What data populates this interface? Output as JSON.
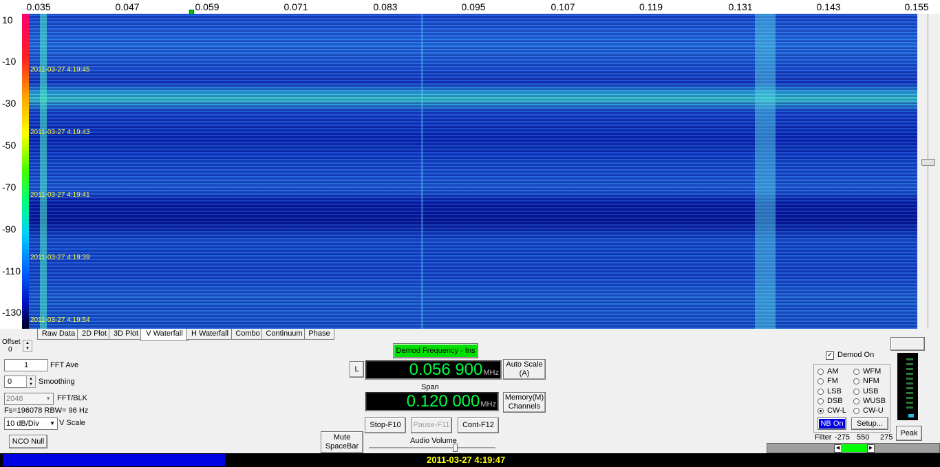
{
  "frequency_axis": {
    "ticks": [
      "0.035",
      "0.047",
      "0.059",
      "0.071",
      "0.083",
      "0.095",
      "0.107",
      "0.119",
      "0.131",
      "0.143",
      "0.155"
    ]
  },
  "db_scale": {
    "ticks": [
      "10",
      "-10",
      "-30",
      "-50",
      "-70",
      "-90",
      "-110",
      "-130"
    ]
  },
  "waterfall": {
    "timestamps": [
      "2011-03-27 4:19:45",
      "2011-03-27 4:19:43",
      "2011-03-27 4:19:41",
      "2011-03-27 4:19:39",
      "2011-03-27 4:19:54"
    ]
  },
  "tabs": [
    {
      "label": "Raw Data",
      "active": false
    },
    {
      "label": "2D Plot",
      "active": false
    },
    {
      "label": "3D Plot",
      "active": false
    },
    {
      "label": "V Waterfall",
      "active": true
    },
    {
      "label": "H Waterfall",
      "active": false
    },
    {
      "label": "Combo",
      "active": false
    },
    {
      "label": "Continuum",
      "active": false
    },
    {
      "label": "Phase",
      "active": false
    }
  ],
  "left_controls": {
    "offset_label": "Offset",
    "offset_value": "0",
    "fft_ave_value": "1",
    "fft_ave_label": "FFT Ave",
    "smoothing_value": "0",
    "smoothing_label": "Smoothing",
    "fft_blk_value": "2048",
    "fft_blk_label": "FFT/BLK",
    "fs_info": "Fs=196078 RBW= 96 Hz",
    "vscale_value": "10 dB/Div",
    "vscale_label": "V Scale",
    "nco_null_label": "NCO Null"
  },
  "center_controls": {
    "demod_freq_button": "Demod Frequency - Ins",
    "l_button": "L",
    "demod_freq_value": "0.056 900",
    "unit": "MHz",
    "auto_scale_label": "Auto Scale (A)",
    "span_label": "Span",
    "span_value": "0.120 000",
    "memory_label": "Memory(M) Channels",
    "stop_label": "Stop-F10",
    "pause_label": "Pause-F11",
    "cont_label": "Cont-F12",
    "mute_label": "Mute SpaceBar",
    "audio_volume_label": "Audio Volume"
  },
  "right_controls": {
    "demod_on_label": "Demod On",
    "demod_on_checked": true,
    "modes": [
      {
        "label": "AM",
        "selected": false
      },
      {
        "label": "WFM",
        "selected": false
      },
      {
        "label": "FM",
        "selected": false
      },
      {
        "label": "NFM",
        "selected": false
      },
      {
        "label": "LSB",
        "selected": false
      },
      {
        "label": "USB",
        "selected": false
      },
      {
        "label": "DSB",
        "selected": false
      },
      {
        "label": "WUSB",
        "selected": false
      },
      {
        "label": "CW-L",
        "selected": true
      },
      {
        "label": "CW-U",
        "selected": false
      }
    ],
    "nb_on_label": "NB On",
    "setup_label": "Setup...",
    "peak_label": "Peak",
    "filter_label": "Filter",
    "filter_low": "-275",
    "filter_width": "550",
    "filter_high": "275"
  },
  "status": {
    "timestamp": "2011-03-27 4:19:47"
  },
  "colors": {
    "demod_button_bg": "#00e000",
    "nb_on_bg": "#0000e0",
    "display_text": "#00ff40"
  }
}
